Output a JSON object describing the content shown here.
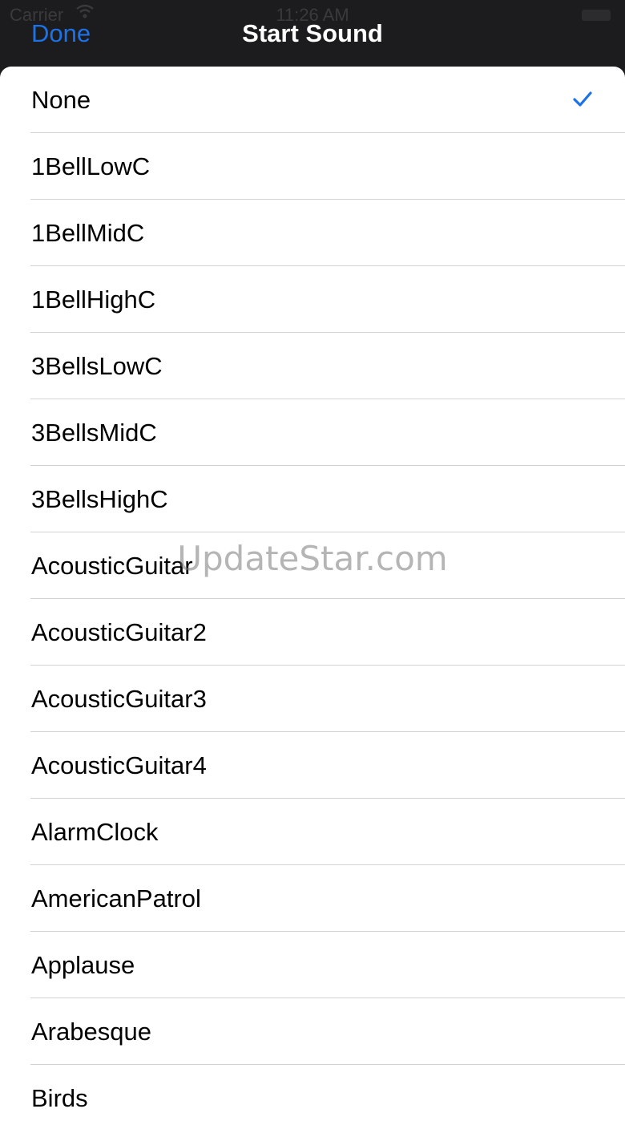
{
  "status_bar": {
    "carrier": "Carrier",
    "time": "11:26 AM"
  },
  "nav": {
    "done_label": "Done",
    "title": "Start Sound"
  },
  "sounds": [
    {
      "label": "None",
      "selected": true
    },
    {
      "label": "1BellLowC",
      "selected": false
    },
    {
      "label": "1BellMidC",
      "selected": false
    },
    {
      "label": "1BellHighC",
      "selected": false
    },
    {
      "label": "3BellsLowC",
      "selected": false
    },
    {
      "label": "3BellsMidC",
      "selected": false
    },
    {
      "label": "3BellsHighC",
      "selected": false
    },
    {
      "label": "AcousticGuitar",
      "selected": false
    },
    {
      "label": "AcousticGuitar2",
      "selected": false
    },
    {
      "label": "AcousticGuitar3",
      "selected": false
    },
    {
      "label": "AcousticGuitar4",
      "selected": false
    },
    {
      "label": "AlarmClock",
      "selected": false
    },
    {
      "label": "AmericanPatrol",
      "selected": false
    },
    {
      "label": "Applause",
      "selected": false
    },
    {
      "label": "Arabesque",
      "selected": false
    },
    {
      "label": "Birds",
      "selected": false
    }
  ],
  "watermark": "UpdateStar.com",
  "icons": {
    "selected": "checkmark-icon",
    "wifi": "wifi-icon",
    "battery": "battery-icon"
  },
  "colors": {
    "accent": "#1d72e8",
    "nav_background": "#1c1c1e",
    "sheet_background": "#ffffff",
    "separator": "#d1d1d6"
  }
}
